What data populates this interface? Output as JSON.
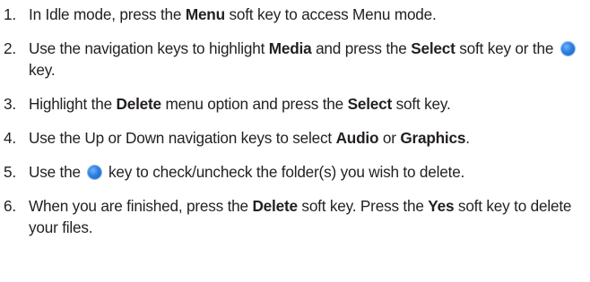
{
  "steps": [
    {
      "num": "1.",
      "parts": [
        {
          "t": "In Idle mode, press the "
        },
        {
          "t": "Menu",
          "b": true
        },
        {
          "t": " soft key to access Menu mode."
        }
      ]
    },
    {
      "num": "2.",
      "parts": [
        {
          "t": "Use the navigation keys to highlight "
        },
        {
          "t": "Media",
          "b": true
        },
        {
          "t": " and press the "
        },
        {
          "t": "Select",
          "b": true
        },
        {
          "t": " soft key or the "
        },
        {
          "icon": "center-key-icon"
        },
        {
          "t": " key."
        }
      ]
    },
    {
      "num": "3.",
      "parts": [
        {
          "t": "Highlight the "
        },
        {
          "t": "Delete",
          "b": true
        },
        {
          "t": " menu option and press the "
        },
        {
          "t": "Select",
          "b": true
        },
        {
          "t": " soft key."
        }
      ]
    },
    {
      "num": "4.",
      "parts": [
        {
          "t": "Use the Up or Down navigation keys to select "
        },
        {
          "t": "Audio",
          "b": true
        },
        {
          "t": " or "
        },
        {
          "t": "Graphics",
          "b": true
        },
        {
          "t": "."
        }
      ]
    },
    {
      "num": "5.",
      "parts": [
        {
          "t": "Use the "
        },
        {
          "icon": "center-key-icon"
        },
        {
          "t": " key to check/uncheck the folder(s) you wish to delete."
        }
      ]
    },
    {
      "num": "6.",
      "parts": [
        {
          "t": "When you are finished, press the "
        },
        {
          "t": "Delete",
          "b": true
        },
        {
          "t": " soft key. Press the "
        },
        {
          "t": "Yes",
          "b": true
        },
        {
          "t": " soft key to delete your files."
        }
      ]
    }
  ],
  "colors": {
    "text": "#231f20",
    "key_icon": "#2d7fe0"
  }
}
